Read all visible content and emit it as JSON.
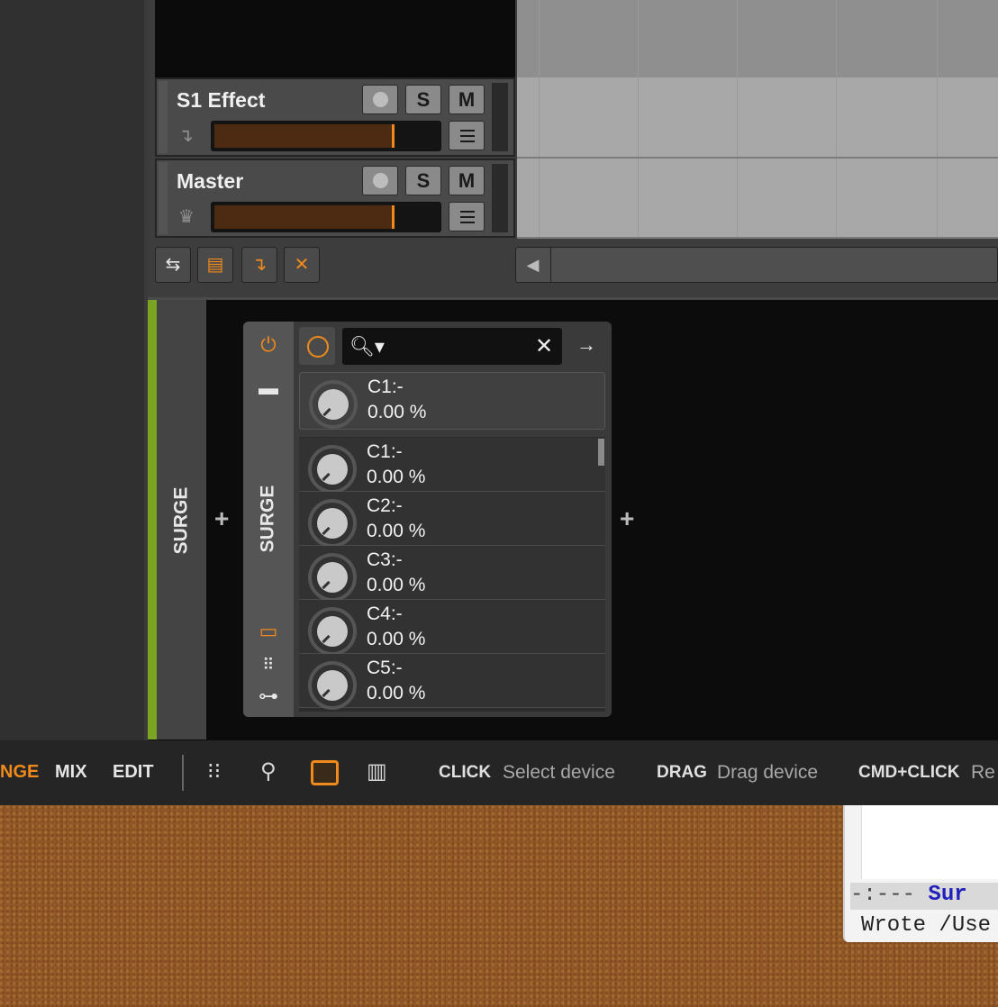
{
  "tracks": [
    {
      "name": "S1 Effect",
      "solo_label": "S",
      "mute_label": "M"
    },
    {
      "name": "Master",
      "solo_label": "S",
      "mute_label": "M"
    }
  ],
  "device_chain": {
    "chain_label": "SURGE",
    "device_label": "SURGE",
    "pinned_param": {
      "name": "C1:-",
      "value": "0.00 %"
    },
    "params": [
      {
        "name": "C1:-",
        "value": "0.00 %"
      },
      {
        "name": "C2:-",
        "value": "0.00 %"
      },
      {
        "name": "C3:-",
        "value": "0.00 %"
      },
      {
        "name": "C4:-",
        "value": "0.00 %"
      },
      {
        "name": "C5:-",
        "value": "0.00 %"
      }
    ]
  },
  "status_bar": {
    "modes": [
      "NGE",
      "MIX",
      "EDIT"
    ],
    "hints": [
      {
        "key": "CLICK",
        "desc": "Select device"
      },
      {
        "key": "DRAG",
        "desc": "Drag device"
      },
      {
        "key": "CMD+CLICK",
        "desc": "Re"
      }
    ]
  },
  "emacs": {
    "modeline_prefix": "-:---  ",
    "modeline_buffer": "Sur",
    "echo": "Wrote /Use"
  },
  "colors": {
    "accent": "#f08a1c",
    "chain_green": "#7aa421",
    "modeline_blue": "#2222bb"
  }
}
